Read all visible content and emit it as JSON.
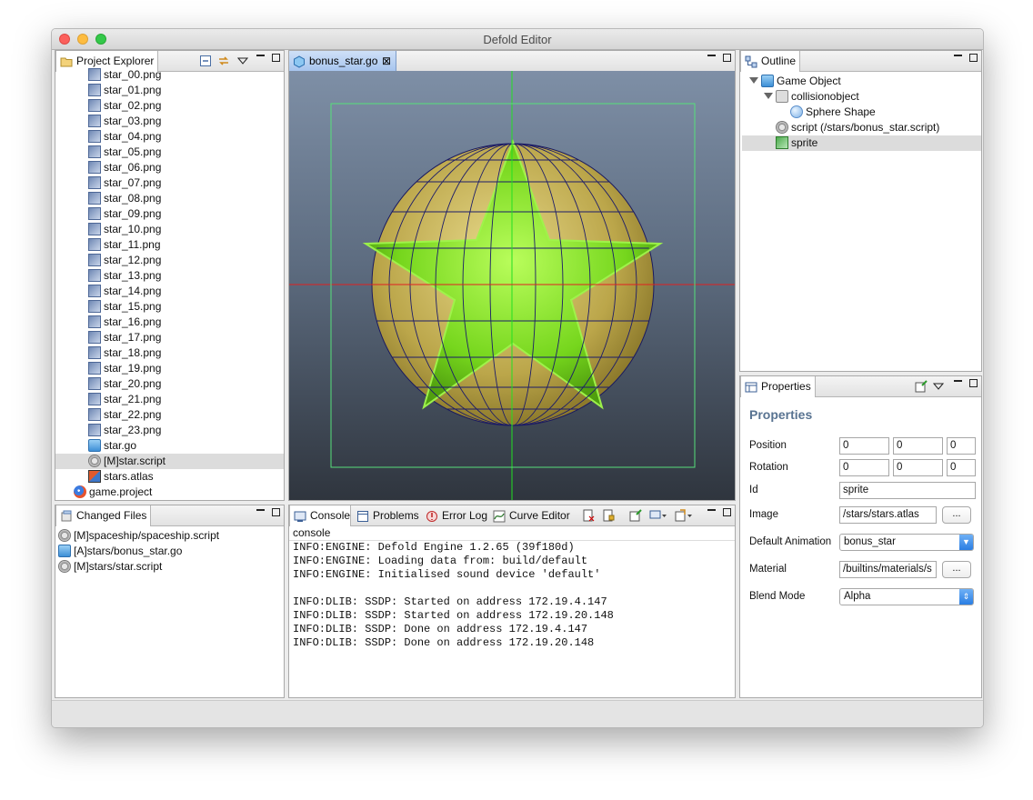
{
  "window": {
    "title": "Defold Editor"
  },
  "project_explorer": {
    "tab_label": "Project Explorer",
    "items": [
      {
        "label": "star_00.png",
        "type": "png"
      },
      {
        "label": "star_01.png",
        "type": "png"
      },
      {
        "label": "star_02.png",
        "type": "png"
      },
      {
        "label": "star_03.png",
        "type": "png"
      },
      {
        "label": "star_04.png",
        "type": "png"
      },
      {
        "label": "star_05.png",
        "type": "png"
      },
      {
        "label": "star_06.png",
        "type": "png"
      },
      {
        "label": "star_07.png",
        "type": "png"
      },
      {
        "label": "star_08.png",
        "type": "png"
      },
      {
        "label": "star_09.png",
        "type": "png"
      },
      {
        "label": "star_10.png",
        "type": "png"
      },
      {
        "label": "star_11.png",
        "type": "png"
      },
      {
        "label": "star_12.png",
        "type": "png"
      },
      {
        "label": "star_13.png",
        "type": "png"
      },
      {
        "label": "star_14.png",
        "type": "png"
      },
      {
        "label": "star_15.png",
        "type": "png"
      },
      {
        "label": "star_16.png",
        "type": "png"
      },
      {
        "label": "star_17.png",
        "type": "png"
      },
      {
        "label": "star_18.png",
        "type": "png"
      },
      {
        "label": "star_19.png",
        "type": "png"
      },
      {
        "label": "star_20.png",
        "type": "png"
      },
      {
        "label": "star_21.png",
        "type": "png"
      },
      {
        "label": "star_22.png",
        "type": "png"
      },
      {
        "label": "star_23.png",
        "type": "png"
      },
      {
        "label": "star.go",
        "type": "go"
      },
      {
        "label": "[M]star.script",
        "type": "script",
        "selected": true
      },
      {
        "label": "stars.atlas",
        "type": "atlas"
      },
      {
        "label": "game.project",
        "type": "project"
      }
    ]
  },
  "changed_files": {
    "tab_label": "Changed Files",
    "items": [
      {
        "label": "[M]spaceship/spaceship.script",
        "type": "script"
      },
      {
        "label": "[A]stars/bonus_star.go",
        "type": "go"
      },
      {
        "label": "[M]stars/star.script",
        "type": "script"
      }
    ]
  },
  "editor": {
    "tab_label": "bonus_star.go"
  },
  "console": {
    "tabs": [
      "Console",
      "Problems",
      "Error Log",
      "Curve Editor"
    ],
    "header": "console",
    "lines": [
      "INFO:ENGINE: Defold Engine 1.2.65 (39f180d)",
      "INFO:ENGINE: Loading data from: build/default",
      "INFO:ENGINE: Initialised sound device 'default'",
      "",
      "INFO:DLIB: SSDP: Started on address 172.19.4.147",
      "INFO:DLIB: SSDP: Started on address 172.19.20.148",
      "INFO:DLIB: SSDP: Done on address 172.19.4.147",
      "INFO:DLIB: SSDP: Done on address 172.19.20.148"
    ]
  },
  "outline": {
    "tab_label": "Outline",
    "items": [
      {
        "label": "Game Object",
        "indent": 0,
        "icon": "go",
        "expander": true
      },
      {
        "label": "collisionobject",
        "indent": 1,
        "icon": "lock",
        "expander": true
      },
      {
        "label": "Sphere Shape",
        "indent": 2,
        "icon": "sphere",
        "expander": false
      },
      {
        "label": "script (/stars/bonus_star.script)",
        "indent": 1,
        "icon": "script",
        "expander": false
      },
      {
        "label": "sprite",
        "indent": 1,
        "icon": "sprite",
        "expander": false,
        "selected": true
      }
    ]
  },
  "properties": {
    "tab_label": "Properties",
    "heading": "Properties",
    "position_label": "Position",
    "position": [
      "0",
      "0",
      "0"
    ],
    "rotation_label": "Rotation",
    "rotation": [
      "0",
      "0",
      "0"
    ],
    "id_label": "Id",
    "id": "sprite",
    "image_label": "Image",
    "image": "/stars/stars.atlas",
    "browse": "...",
    "default_animation_label": "Default Animation",
    "default_animation": "bonus_star",
    "material_label": "Material",
    "material": "/builtins/materials/s",
    "blend_mode_label": "Blend Mode",
    "blend_mode": "Alpha"
  },
  "colors": {
    "star_green": "#8fe82a",
    "sphere_yellow": "#cbb95a",
    "selection_box": "#56e07a",
    "axis_x": "#e02020",
    "axis_y": "#20e020"
  }
}
